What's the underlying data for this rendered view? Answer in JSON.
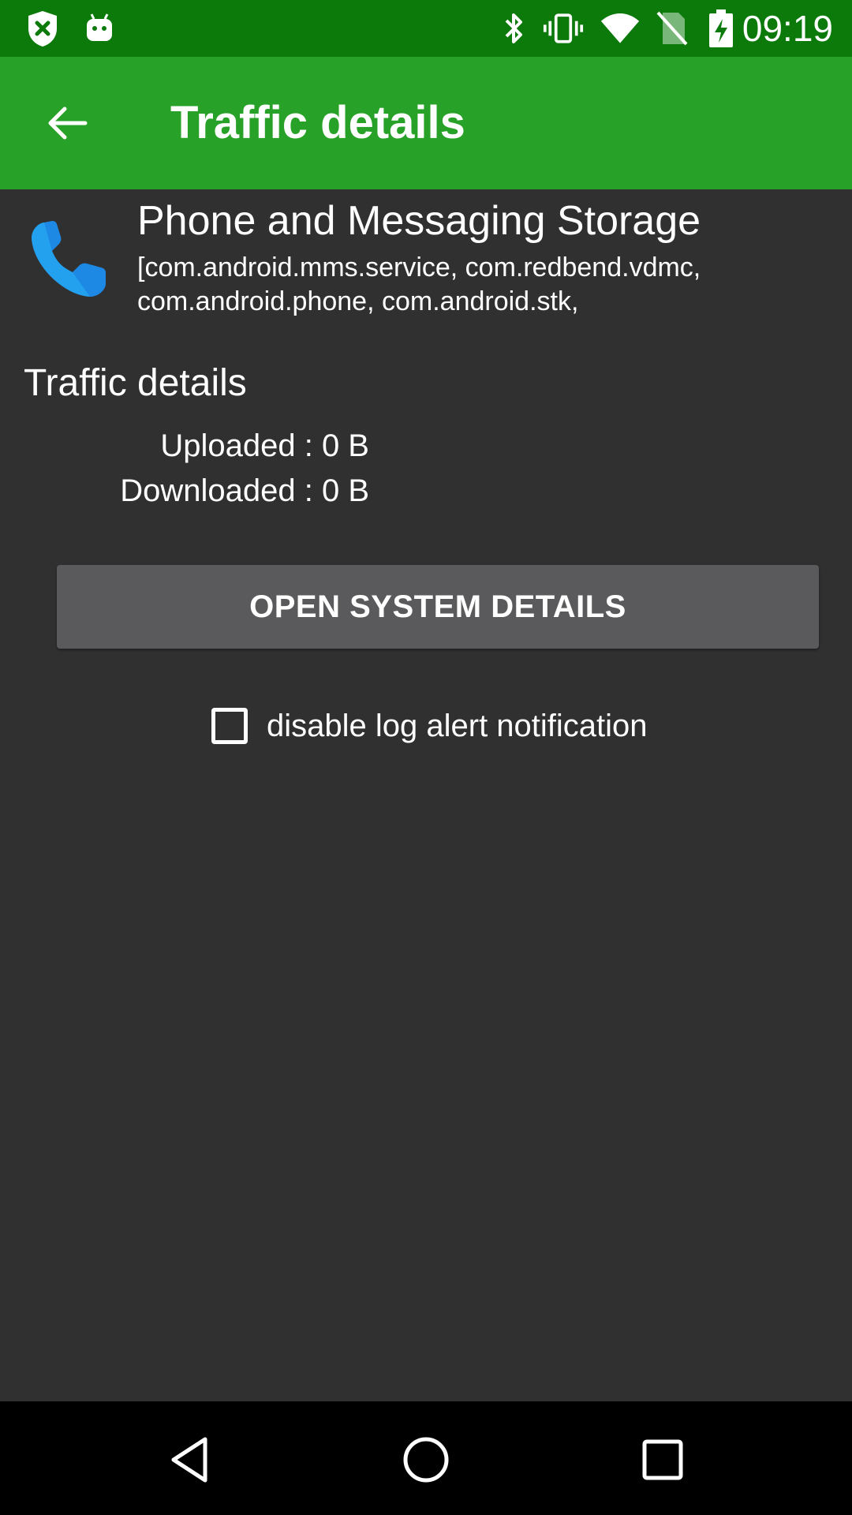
{
  "status_bar": {
    "time": "09:19",
    "icons": [
      "shield-x-icon",
      "android-icon",
      "bluetooth-icon",
      "vibrate-icon",
      "wifi-icon",
      "no-sim-icon",
      "battery-charging-icon"
    ],
    "background": "#0b7a0b"
  },
  "toolbar": {
    "title": "Traffic details",
    "back_icon": "arrow-left-icon",
    "background": "#27a127"
  },
  "app": {
    "icon": "phone-icon",
    "name": "Phone and Messaging Storage",
    "packages": "[com.android.mms.service, com.redbend.vdmc, com.android.phone, com.android.stk,"
  },
  "traffic": {
    "heading": "Traffic details",
    "uploaded": "Uploaded : 0 B",
    "downloaded": "Downloaded : 0 B"
  },
  "actions": {
    "open_system_details": "OPEN SYSTEM DETAILS"
  },
  "options": {
    "disable_log_alert_label": "disable log alert notification",
    "disable_log_alert_checked": false
  },
  "nav_bar": {
    "icons": [
      "back-triangle-icon",
      "home-circle-icon",
      "recents-square-icon"
    ]
  }
}
